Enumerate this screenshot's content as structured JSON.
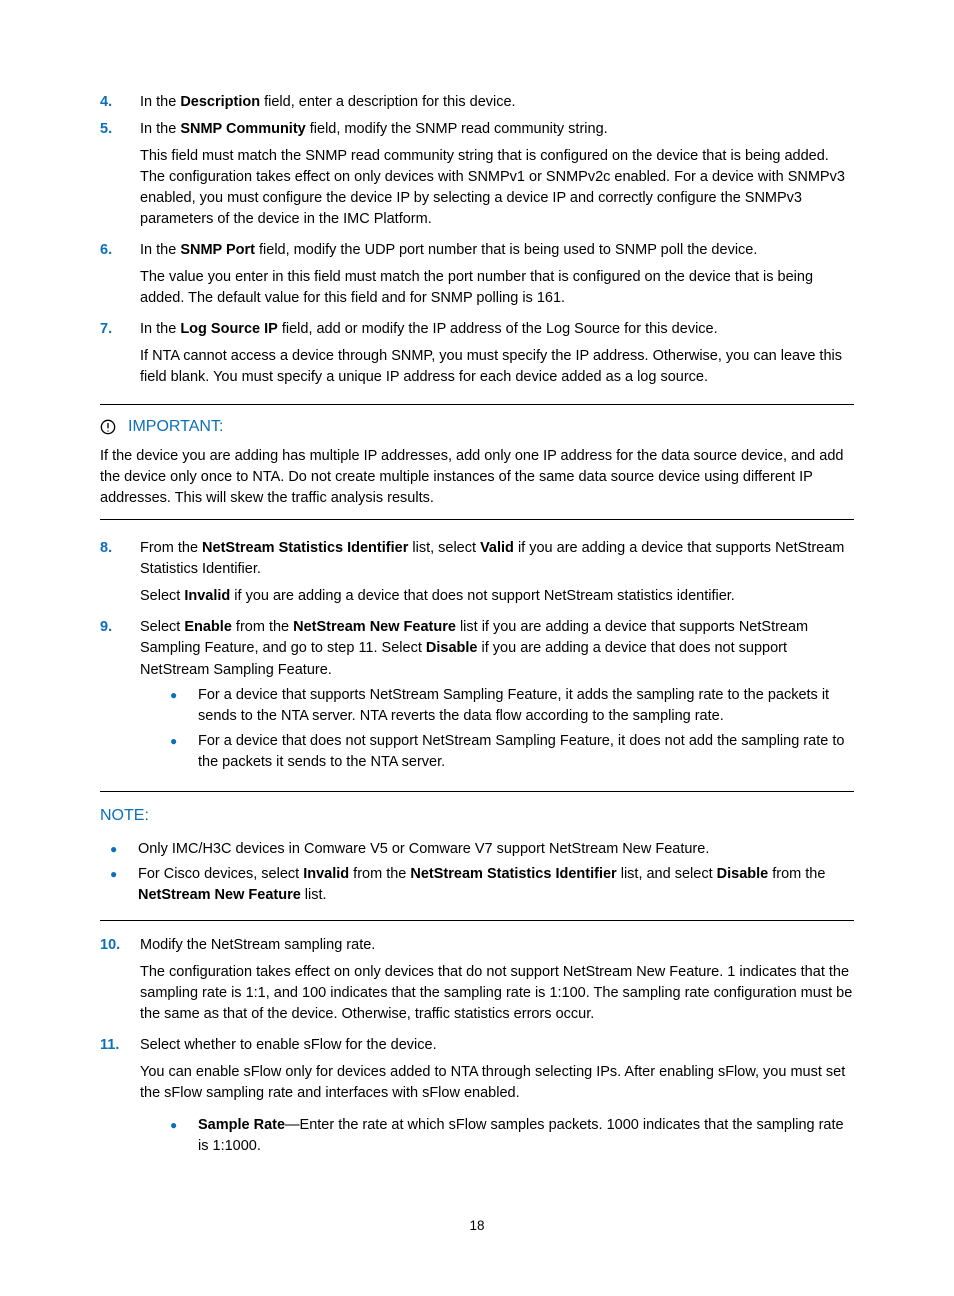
{
  "page_number": "18",
  "steps": {
    "s4": {
      "num": "4.",
      "pre": "In the ",
      "bold1": "Description",
      "post": " field, enter a description for this device."
    },
    "s5": {
      "num": "5.",
      "pre": "In the ",
      "bold1": "SNMP Community",
      "post": " field, modify the SNMP read community string.",
      "para1": "This field must match the SNMP read community string that is configured on the device that is being added. The configuration takes effect on only devices with SNMPv1 or SNMPv2c enabled. For a device with SNMPv3 enabled, you must configure the device IP by selecting a device IP and correctly configure the SNMPv3 parameters of the device in the IMC Platform."
    },
    "s6": {
      "num": "6.",
      "pre": "In the ",
      "bold1": "SNMP Port",
      "post": " field, modify the UDP port number that is being used to SNMP poll the device.",
      "para1": "The value you enter in this field must match the port number that is configured on the device that is being added. The default value for this field and for SNMP polling is 161."
    },
    "s7": {
      "num": "7.",
      "pre": "In the ",
      "bold1": "Log Source IP",
      "post": " field, add or modify the IP address of the Log Source for this device.",
      "para1": "If NTA cannot access a device through SNMP, you must specify the IP address. Otherwise, you can leave this field blank. You must specify a unique IP address for each device added as a log source."
    },
    "s8": {
      "num": "8.",
      "pre": "From the ",
      "bold1": "NetStream Statistics Identifier",
      "mid1": " list, select ",
      "bold2": "Valid",
      "post": " if you are adding a device that supports NetStream Statistics Identifier.",
      "para1_pre": "Select ",
      "para1_bold": "Invalid",
      "para1_post": " if you are adding a device that does not support NetStream statistics identifier."
    },
    "s9": {
      "num": "9.",
      "pre": "Select ",
      "bold1": "Enable",
      "mid1": " from the ",
      "bold2": "NetStream New Feature",
      "mid2": " list if you are adding a device that supports NetStream Sampling Feature, and go to step 11. Select ",
      "bold3": "Disable",
      "post": " if you are adding a device that does not support NetStream Sampling Feature.",
      "bullets": [
        "For a device that supports NetStream Sampling Feature, it adds the sampling rate to the packets it sends to the NTA server. NTA reverts the data flow according to the sampling rate.",
        "For a device that does not support NetStream Sampling Feature, it does not add the sampling rate to the packets it sends to the NTA server."
      ]
    },
    "s10": {
      "num": "10.",
      "text": "Modify the NetStream sampling rate.",
      "para1": "The configuration takes effect on only devices that do not support NetStream New Feature. 1 indicates that the sampling rate is 1:1, and 100 indicates that the sampling rate is 1:100. The sampling rate configuration must be the same as that of the device. Otherwise, traffic statistics errors occur."
    },
    "s11": {
      "num": "11.",
      "text": "Select whether to enable sFlow for the device.",
      "para1": "You can enable sFlow only for devices added to NTA through selecting IPs. After enabling sFlow, you must set the sFlow sampling rate and interfaces with sFlow enabled.",
      "b1_bold": "Sample Rate",
      "b1_rest": "—Enter the rate at which sFlow samples packets. 1000 indicates that the sampling rate is 1:1000."
    }
  },
  "important": {
    "label": "IMPORTANT:",
    "body": "If the device you are adding has multiple IP addresses, add only one IP address for the data source device, and add the device only once to NTA. Do not create multiple instances of the same data source device using different IP addresses. This will skew the traffic analysis results."
  },
  "note": {
    "label": "NOTE:",
    "b1": "Only IMC/H3C devices in Comware V5 or Comware V7 support NetStream New Feature.",
    "b2_pre": "For Cisco devices, select ",
    "b2_bold1": "Invalid",
    "b2_mid1": " from the ",
    "b2_bold2": "NetStream Statistics Identifier",
    "b2_mid2": " list, and select ",
    "b2_bold3": "Disable",
    "b2_mid3": " from the ",
    "b2_bold4": "NetStream New Feature",
    "b2_post": " list."
  }
}
